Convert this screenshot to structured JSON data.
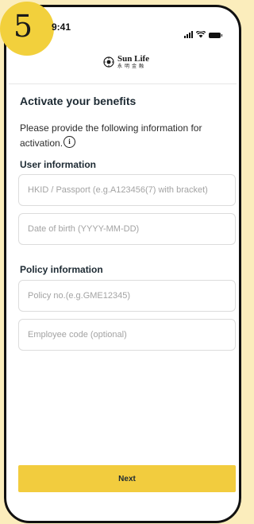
{
  "step": {
    "number": "5"
  },
  "status_bar": {
    "time": "9:41"
  },
  "brand": {
    "name": "Sun Life",
    "chinese_name": "永明金融"
  },
  "page": {
    "title": "Activate your benefits",
    "description": "Please provide the following information for activation."
  },
  "user_section": {
    "heading": "User information",
    "id_placeholder": "HKID / Passport (e.g.A123456(7) with bracket)",
    "dob_placeholder": "Date of birth (YYYY-MM-DD)"
  },
  "policy_section": {
    "heading": "Policy information",
    "policy_placeholder": "Policy no.(e.g.GME12345)",
    "employee_placeholder": "Employee code (optional)"
  },
  "actions": {
    "next_label": "Next"
  },
  "colors": {
    "accent": "#f2cc3e",
    "background": "#fbedbc",
    "text": "#1d2a33"
  },
  "icons": [
    "signal-icon",
    "wifi-icon",
    "battery-icon",
    "sunlife-logo-icon",
    "info-icon"
  ]
}
